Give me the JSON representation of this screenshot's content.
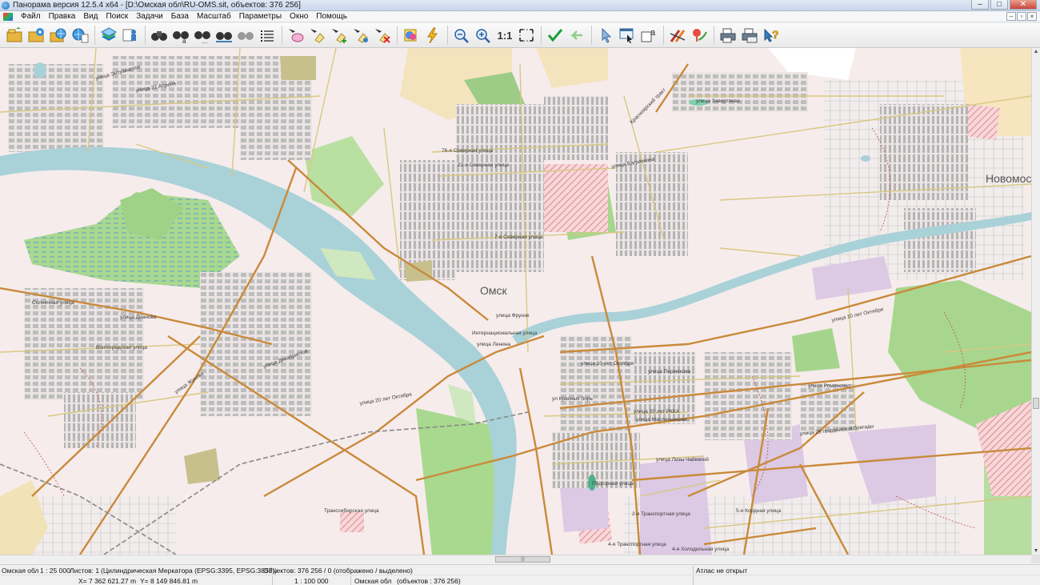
{
  "window": {
    "title": "Панорама версия 12.5.4 x64 - [D:\\Омская обл\\RU-OMS.sit, объектов: 376 256]",
    "controls": [
      "–",
      "□",
      "✕"
    ]
  },
  "menu": {
    "items": [
      "Файл",
      "Правка",
      "Вид",
      "Поиск",
      "Задачи",
      "База",
      "Масштаб",
      "Параметры",
      "Окно",
      "Помощь"
    ]
  },
  "toolbar": {
    "scale_label": "1:1"
  },
  "map": {
    "city_labels": {
      "omsk": "Омск",
      "novomoskovka": "Новомоско"
    },
    "streets": {
      "s76": "76-я Северная улица",
      "s22": "22-я Северная улица",
      "s7": "7-я Северная улица",
      "internatsionalnaya": "Интернациональная улица",
      "frunze": "улица Фрунзе",
      "lenina": "улица Ленина",
      "dekabristov": "улица Декабристов",
      "oktyabr_10": "улица 10 лет Октября",
      "oktyabr_10_east": "улица 10 лет Октября",
      "permyakova": "улица Пермякова",
      "krasnykh_zor": "ул Красных Зорь",
      "rkka": "улица 20 лет РККА",
      "maslennikova": "улица Масленникова",
      "romanenko": "улица Романенко",
      "gvard_brigada": "улица 29 гвардейской бригады",
      "lineinaya": "улица Лизы Чайкиной",
      "podgornaya": "Подгорная улица",
      "transportnaya": "2-я Транспортная улица",
      "kholodilnaya": "5-я Кордная улица",
      "transportnaya4": "4-я Транспортная улица",
      "kholodilnaya2": "4-я Холодильная улица",
      "oktyabr_20": "улица 20 лет Октября",
      "transsib": "Транссибирская улица",
      "volgogradskaya": "Волгоградская улица",
      "zhukova": "улица Жукова",
      "dianova": "улица Дианова",
      "sologubova": "Солнечная улица",
      "zavertyaeva": "улица Завертяева",
      "bagrationa": "улица Багратиона",
      "karbysheva": "Красноярский тракт",
      "enthusiasts": "улица Энтузиастов",
      "22aprelya": "улица 22 Апреля"
    }
  },
  "status": {
    "row1": {
      "map_name": "Омская обл",
      "scale": "1 : 25 000",
      "sheets": "Листов: 1",
      "projection": "(Цилиндрическая Меркатора (EPSG:3395, EPSG:3857))",
      "objects": "Объектов: 376 256 / 0 (отображено / выделено)",
      "atlas": "Атлас не открыт"
    },
    "row2": {
      "x": "X= 7 362 621.27 m",
      "y": "Y= 8 149 846.81 m",
      "scale_ratio": "1 : 100 000",
      "map_name": "Омская обл",
      "objects": "(объектов : 376 256)"
    }
  },
  "colors": {
    "map_background": "#f6ecec",
    "river": "#a9d1d8",
    "forest": "#a7d68f",
    "road_major": "#c98a3a",
    "road_minor": "#d8c880",
    "blocks": "#b9b9b9",
    "industrial": "#dcc9e4",
    "hatched": "#e7a7ae",
    "title_bar": "#c9d7ea"
  }
}
